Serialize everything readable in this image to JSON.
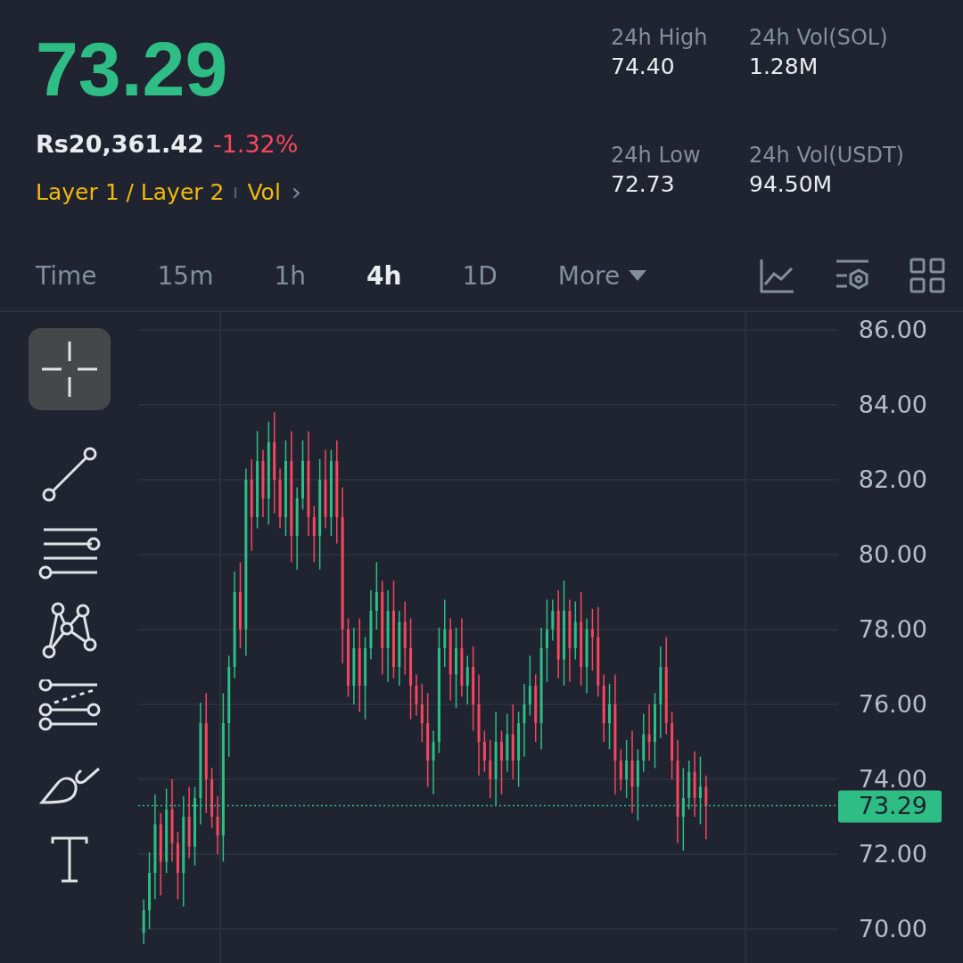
{
  "price": {
    "last": "73.29",
    "fiat": "Rs20,361.42",
    "change": "-1.32%"
  },
  "tags": [
    {
      "label": "Layer 1 / Layer 2"
    },
    {
      "label": "Vol"
    }
  ],
  "more_arrow": "›",
  "stats": [
    {
      "label": "24h High",
      "value": "74.40"
    },
    {
      "label": "24h Vol(SOL)",
      "value": "1.28M"
    },
    {
      "label": "24h Low",
      "value": "72.73"
    },
    {
      "label": "24h Vol(USDT)",
      "value": "94.50M"
    }
  ],
  "intervals": [
    {
      "label": "Time",
      "selected": false
    },
    {
      "label": "15m",
      "selected": false
    },
    {
      "label": "1h",
      "selected": false
    },
    {
      "label": "4h",
      "selected": true
    },
    {
      "label": "1D",
      "selected": false
    },
    {
      "label": "More",
      "selected": false,
      "dropdown": true
    }
  ],
  "chart_tools": [
    {
      "kind": "indicator"
    },
    {
      "kind": "settings"
    },
    {
      "kind": "layout"
    }
  ],
  "drawing_tools": [
    {
      "kind": "crosshair",
      "selected": true
    },
    {
      "kind": "trendline",
      "selected": false
    },
    {
      "kind": "fib",
      "selected": false
    },
    {
      "kind": "pattern",
      "selected": false
    },
    {
      "kind": "channel",
      "selected": false
    },
    {
      "kind": "brush",
      "selected": false
    },
    {
      "kind": "text",
      "selected": false
    }
  ],
  "chart": {
    "price_tag": "73.29",
    "y_labels": [
      "86.00",
      "84.00",
      "82.00",
      "80.00",
      "78.00",
      "76.00",
      "74.00",
      "72.00",
      "70.00"
    ]
  }
}
